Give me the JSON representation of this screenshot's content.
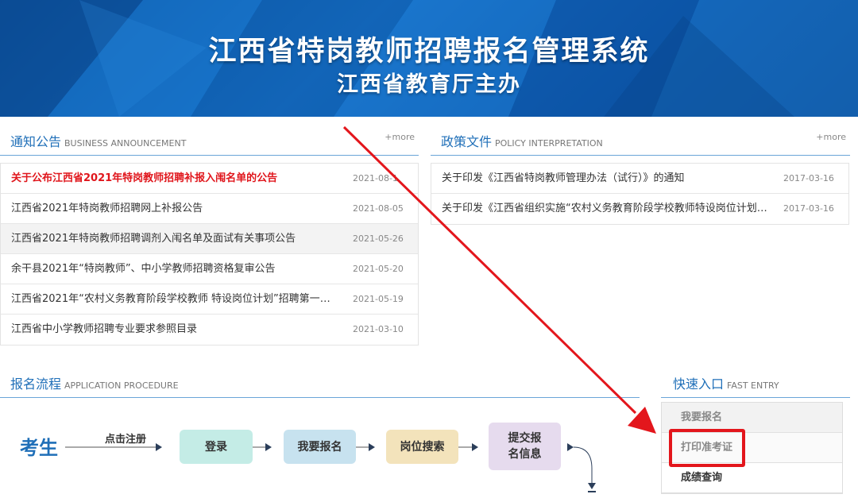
{
  "banner": {
    "title": "江西省特岗教师招聘报名管理系统",
    "subtitle": "江西省教育厅主办"
  },
  "notices": {
    "title_cn": "通知公告",
    "title_en": "BUSINESS ANNOUNCEMENT",
    "more": "+more",
    "items": [
      {
        "title": "关于公布江西省2021年特岗教师招聘补报入闱名单的公告",
        "date": "2021-08-1"
      },
      {
        "title": "江西省2021年特岗教师招聘网上补报公告",
        "date": "2021-08-05"
      },
      {
        "title": "江西省2021年特岗教师招聘调剂入闱名单及面试有关事项公告",
        "date": "2021-05-26"
      },
      {
        "title": "余干县2021年“特岗教师”、中小学教师招聘资格复审公告",
        "date": "2021-05-20"
      },
      {
        "title": "江西省2021年“农村义务教育阶段学校教师 特设岗位计划”招聘第一批…",
        "date": "2021-05-19"
      },
      {
        "title": "江西省中小学教师招聘专业要求参照目录",
        "date": "2021-03-10"
      }
    ]
  },
  "policy": {
    "title_cn": "政策文件",
    "title_en": "POLICY INTERPRETATION",
    "more": "+more",
    "items": [
      {
        "title": "关于印发《江西省特岗教师管理办法（试行）》的通知",
        "date": "2017-03-16"
      },
      {
        "title": "关于印发《江西省组织实施“农村义务教育阶段学校教师特设岗位计划”…",
        "date": "2017-03-16"
      }
    ]
  },
  "procedure": {
    "title_cn": "报名流程",
    "title_en": "APPLICATION PROCEDURE",
    "actor": "考生",
    "first_label": "点击注册",
    "steps": [
      "登录",
      "我要报名",
      "岗位搜索",
      "提交报\n名信息"
    ],
    "step_colors": [
      "#c4ece6",
      "#c7e2ef",
      "#f3e3bb",
      "#e6dbee"
    ]
  },
  "fast_entry": {
    "title_cn": "快速入口",
    "title_en": "FAST ENTRY",
    "items": [
      "我要报名",
      "打印准考证",
      "成绩查询"
    ]
  },
  "colors": {
    "accent_blue": "#1f6fb8",
    "highlight_red": "#e3161c"
  }
}
